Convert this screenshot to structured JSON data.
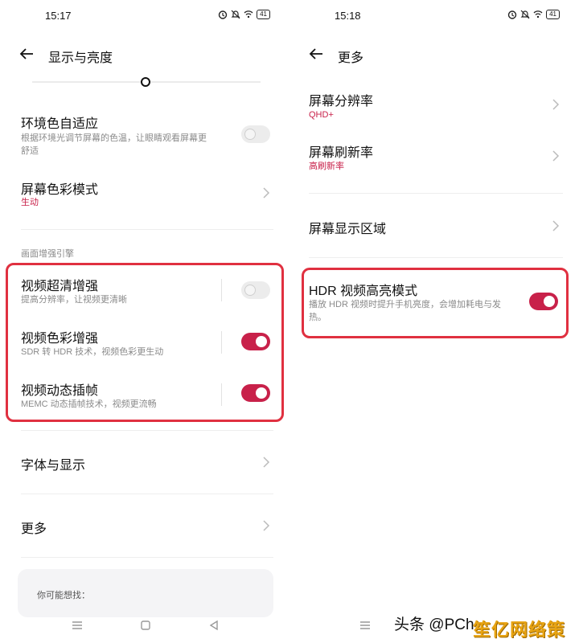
{
  "left": {
    "status": {
      "time": "15:17",
      "battery": "41"
    },
    "appbar": {
      "title": "显示与亮度"
    },
    "ambient": {
      "title": "环境色自适应",
      "sub1": "根据环境光调节屏幕的色温，让眼睛观看屏幕更",
      "sub2": "舒适",
      "toggle": "off"
    },
    "color_mode": {
      "title": "屏幕色彩模式",
      "value": "生动"
    },
    "section_header": "画面增强引擎",
    "enhance_items": [
      {
        "title": "视频超清增强",
        "sub": "提高分辨率，让视频更清晰",
        "toggle": "off"
      },
      {
        "title": "视频色彩增强",
        "sub": "SDR 转 HDR 技术，视频色彩更生动",
        "toggle": "on"
      },
      {
        "title": "视频动态插帧",
        "sub": "MEMC 动态插帧技术，视频更流畅",
        "toggle": "on"
      }
    ],
    "font_display": {
      "title": "字体与显示"
    },
    "more": {
      "title": "更多"
    },
    "suggest": {
      "label": "你可能想找："
    }
  },
  "right": {
    "status": {
      "time": "15:18",
      "battery": "41"
    },
    "appbar": {
      "title": "更多"
    },
    "resolution": {
      "title": "屏幕分辨率",
      "value": "QHD+"
    },
    "refresh": {
      "title": "屏幕刷新率",
      "value": "高刷新率"
    },
    "display_area": {
      "title": "屏幕显示区域"
    },
    "hdr": {
      "title": "HDR 视频高亮模式",
      "sub1": "播放 HDR 视频时提升手机亮度，会增加耗电与发",
      "sub2": "热。",
      "toggle": "on"
    }
  },
  "watermark": {
    "source": "头条 @PCh",
    "brand": "笙亿网络策划"
  },
  "colors": {
    "accent": "#c8214a",
    "highlight": "#e03040",
    "watermark": "#e7a312"
  },
  "icons": [
    "back-arrow-icon",
    "chevron-right-icon",
    "alarm-icon",
    "mute-bell-icon",
    "wifi-icon",
    "battery-icon",
    "menu-icon",
    "home-icon",
    "back-triangle-icon"
  ]
}
